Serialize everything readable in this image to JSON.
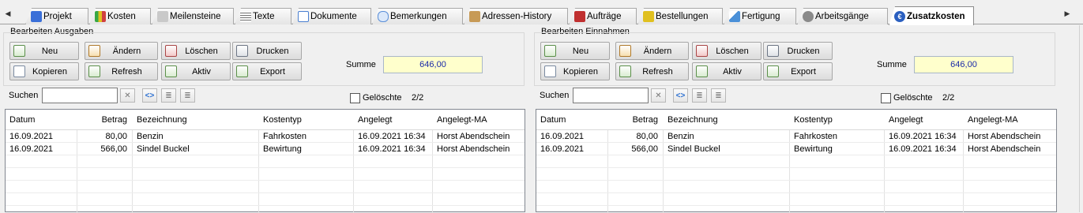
{
  "tabs": [
    {
      "label": "Projekt",
      "icon": "project-icon",
      "color": "#3a6fd8"
    },
    {
      "label": "Kosten",
      "icon": "costs-chart-icon",
      "color": "#39a845"
    },
    {
      "label": "Meilensteine",
      "icon": "milestones-icon",
      "color": "#b5b5b5"
    },
    {
      "label": "Texte",
      "icon": "texts-icon",
      "color": "#707070"
    },
    {
      "label": "Dokumente",
      "icon": "documents-icon",
      "color": "#4a7fd0"
    },
    {
      "label": "Bemerkungen",
      "icon": "remarks-icon",
      "color": "#5b8fd8"
    },
    {
      "label": "Adressen-History",
      "icon": "address-history-icon",
      "color": "#c79a56"
    },
    {
      "label": "Aufträge",
      "icon": "orders-book-icon",
      "color": "#c03030"
    },
    {
      "label": "Bestellungen",
      "icon": "purchase-orders-icon",
      "color": "#e0c020"
    },
    {
      "label": "Fertigung",
      "icon": "production-icon",
      "color": "#4a90d8"
    },
    {
      "label": "Arbeitsgänge",
      "icon": "work-steps-gear-icon",
      "color": "#8a8a8a"
    },
    {
      "label": "Zusatzkosten",
      "icon": "additional-costs-euro-icon",
      "color": "#2a5fc0"
    }
  ],
  "left": {
    "group_title": "Bearbeiten Ausgaben",
    "buttons": {
      "neu": "Neu",
      "aendern": "Ändern",
      "loeschen": "Löschen",
      "drucken": "Drucken",
      "kopieren": "Kopieren",
      "refresh": "Refresh",
      "aktiv": "Aktiv",
      "export": "Export"
    },
    "summe_label": "Summe",
    "summe_value": "646,00",
    "search_label": "Suchen",
    "search_value": "",
    "deleted_label": "Gelöschte",
    "count": "2/2",
    "columns": [
      "Datum",
      "Betrag",
      "Bezeichnung",
      "Kostentyp",
      "Angelegt",
      "Angelegt-MA"
    ],
    "rows": [
      [
        "16.09.2021",
        "80,00",
        "Benzin",
        "Fahrkosten",
        "16.09.2021 16:34",
        "Horst Abendschein"
      ],
      [
        "16.09.2021",
        "566,00",
        "Sindel Buckel",
        "Bewirtung",
        "16.09.2021 16:34",
        "Horst Abendschein"
      ]
    ]
  },
  "right": {
    "group_title": "Bearbeiten Einnahmen",
    "buttons": {
      "neu": "Neu",
      "aendern": "Ändern",
      "loeschen": "Löschen",
      "drucken": "Drucken",
      "kopieren": "Kopieren",
      "refresh": "Refresh",
      "aktiv": "Aktiv",
      "export": "Export"
    },
    "summe_label": "Summe",
    "summe_value": "646,00",
    "search_label": "Suchen",
    "search_value": "",
    "deleted_label": "Gelöschte",
    "count": "2/2",
    "columns": [
      "Datum",
      "Betrag",
      "Bezeichnung",
      "Kostentyp",
      "Angelegt",
      "Angelegt-MA"
    ],
    "rows": [
      [
        "16.09.2021",
        "80,00",
        "Benzin",
        "Fahrkosten",
        "16.09.2021 16:34",
        "Horst Abendschein"
      ],
      [
        "16.09.2021",
        "566,00",
        "Sindel Buckel",
        "Bewirtung",
        "16.09.2021 16:34",
        "Horst Abendschein"
      ]
    ]
  }
}
